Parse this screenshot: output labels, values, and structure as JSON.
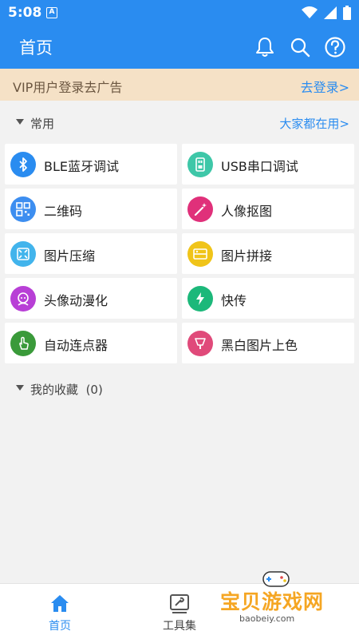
{
  "status_bar": {
    "time": "5:08",
    "notif_glyph": "A",
    "icons": [
      "wifi-icon",
      "signal-icon",
      "battery-icon"
    ]
  },
  "app_bar": {
    "title": "首页",
    "icons": [
      "bell-icon",
      "search-icon",
      "help-icon"
    ]
  },
  "vip_banner": {
    "text": "VIP用户登录去广告",
    "link": "去登录>"
  },
  "common_section": {
    "title": "常用",
    "link": "大家都在用>",
    "items": [
      {
        "label": "BLE蓝牙调试",
        "icon": "bluetooth-icon",
        "color": "#2a8cf0"
      },
      {
        "label": "USB串口调试",
        "icon": "usb-serial-icon",
        "color": "#3ec7a8"
      },
      {
        "label": "二维码",
        "icon": "qr-code-icon",
        "color": "#3d8ef0"
      },
      {
        "label": "人像抠图",
        "icon": "magic-wand-icon",
        "color": "#e0307a"
      },
      {
        "label": "图片压缩",
        "icon": "image-compress-icon",
        "color": "#42b4ec"
      },
      {
        "label": "图片拼接",
        "icon": "image-stitch-icon",
        "color": "#f0c419"
      },
      {
        "label": "头像动漫化",
        "icon": "anime-avatar-icon",
        "color": "#b83fd6"
      },
      {
        "label": "快传",
        "icon": "lightning-icon",
        "color": "#1cb87a"
      },
      {
        "label": "自动连点器",
        "icon": "tap-hand-icon",
        "color": "#3a9a3a"
      },
      {
        "label": "黑白图片上色",
        "icon": "paint-icon",
        "color": "#e04a7a"
      }
    ]
  },
  "favorites_section": {
    "title": "我的收藏",
    "count": "(0)"
  },
  "bottom_nav": {
    "items": [
      {
        "label": "首页",
        "icon": "home-icon",
        "active": true
      },
      {
        "label": "工具集",
        "icon": "toolbox-icon",
        "active": false
      }
    ]
  },
  "watermark": {
    "text": "宝贝游戏网",
    "url": "baobeiy.com"
  },
  "colors": {
    "primary": "#2a8cf0",
    "vip_bg": "#f5e1c6",
    "background": "#f2f2f2"
  }
}
